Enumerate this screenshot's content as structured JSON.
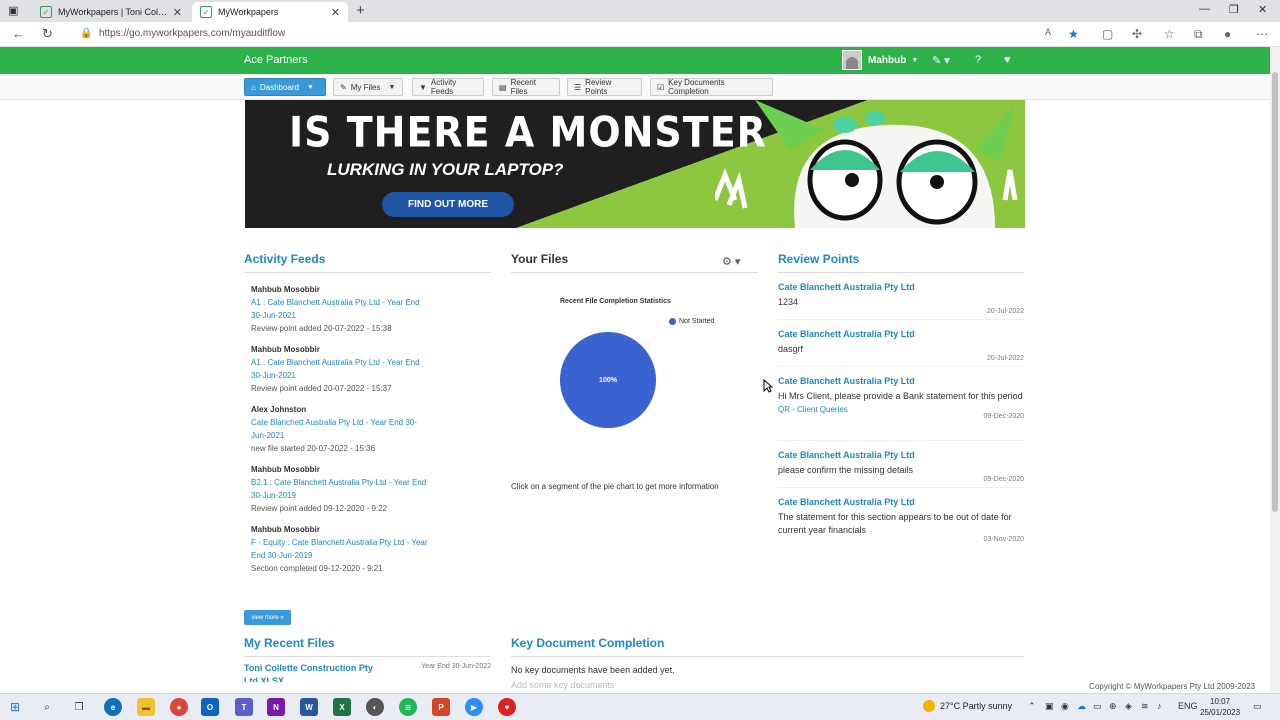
{
  "browser": {
    "tabs": [
      {
        "title": "MyWorkpapers | Toni Collette Co"
      },
      {
        "title": "MyWorkpapers"
      }
    ],
    "url": "https://go.myworkpapers.com/myauditflow"
  },
  "header": {
    "brand": "Ace Partners",
    "user": "Mahbub"
  },
  "nav": {
    "dashboard": "Dashboard",
    "my_files": "My Files",
    "activity_feeds": "Activity Feeds",
    "recent_files": "Recent Files",
    "review_points": "Review Points",
    "key_documents": "Key Documents Completion"
  },
  "banner": {
    "headline": "IS THERE A MONSTER",
    "subline": "LURKING IN YOUR LAPTOP?",
    "cta": "FIND OUT MORE"
  },
  "activity": {
    "title": "Activity Feeds",
    "items": [
      {
        "name": "Mahbub Mosobbir",
        "link": "A1 : Cate Blanchett Australia Pty Ltd - Year End 30-Jun-2021",
        "meta": "Review point added 20-07-2022 - 15:38"
      },
      {
        "name": "Mahbub Mosobbir",
        "link": "A1 : Cate Blanchett Australia Pty Ltd - Year End 30-Jun-2021",
        "meta": "Review point added 20-07-2022 - 15:37"
      },
      {
        "name": "Alex Johnston",
        "link": "Cate Blanchett Australia Pty Ltd - Year End 30-Jun-2021",
        "meta": "new file started 20-07-2022 - 15:36"
      },
      {
        "name": "Mahbub Mosobbir",
        "link": "B2.1 : Cate Blanchett Australia Pty Ltd - Year End 30-Jun-2019",
        "meta": "Review point added 09-12-2020 - 9:22"
      },
      {
        "name": "Mahbub Mosobbir",
        "link": "F - Equity : Cate Blanchett Australia Pty Ltd - Year End 30-Jun-2019",
        "meta": "Section completed 09-12-2020 - 9:21"
      }
    ],
    "view_more": "view more »"
  },
  "files": {
    "title": "Your Files",
    "hint": "Click on a segment of the pie chart to get more information"
  },
  "chart_data": {
    "type": "pie",
    "title": "Recent File Completion Statistics",
    "categories": [
      "Not Started"
    ],
    "values": [
      100
    ],
    "slice_label": "100%",
    "colors": [
      "#3a62d0"
    ],
    "legend": "top-right"
  },
  "review": {
    "title": "Review Points",
    "items": [
      {
        "client": "Cate Blanchett Australia Pty Ltd",
        "text": "1234",
        "date": "20-Jul-2022",
        "tag": ""
      },
      {
        "client": "Cate Blanchett Australia Pty Ltd",
        "text": "dasgrf",
        "date": "20-Jul-2022",
        "tag": ""
      },
      {
        "client": "Cate Blanchett Australia Pty Ltd",
        "text": "Hi Mrs Client, please provide a Bank statement for this period",
        "date": "09-Dec-2020",
        "tag": "QR - Client Queries"
      },
      {
        "client": "Cate Blanchett Australia Pty Ltd",
        "text": "please confirm the missing details",
        "date": "09-Dec-2020",
        "tag": ""
      },
      {
        "client": "Cate Blanchett Australia Pty Ltd",
        "text": "The statement for this section appears to be out of date for current year financials",
        "date": "03-Nov-2020",
        "tag": ""
      }
    ]
  },
  "recent": {
    "title": "My Recent Files",
    "file": "Toni Collette Construction Pty Ltd.XLSX",
    "year_end": "Year End 30-Jun-2022"
  },
  "keydocs": {
    "title": "Key Document Completion",
    "empty": "No key documents have been added yet.",
    "add": "Add some key documents"
  },
  "footer": {
    "copyright": "Copyright © MyWorkpapers Pty Ltd 2009-2023"
  },
  "taskbar": {
    "weather": "27°C  Partly sunny",
    "lang": "ENG",
    "time": "10:07",
    "date": "25/01/2023"
  }
}
